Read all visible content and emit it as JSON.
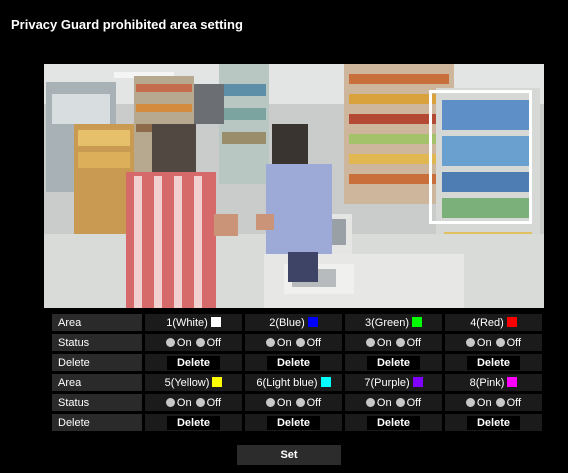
{
  "page": {
    "title": "Privacy Guard prohibited area setting"
  },
  "areas_row1": [
    {
      "label": "1(White)",
      "color": "#ffffff"
    },
    {
      "label": "2(Blue)",
      "color": "#0000ff"
    },
    {
      "label": "3(Green)",
      "color": "#00ff00"
    },
    {
      "label": "4(Red)",
      "color": "#ff0000"
    }
  ],
  "areas_row2": [
    {
      "label": "5(Yellow)",
      "color": "#ffff00"
    },
    {
      "label": "6(Light blue)",
      "color": "#00ffff"
    },
    {
      "label": "7(Purple)",
      "color": "#8000ff"
    },
    {
      "label": "8(Pink)",
      "color": "#ff00ff"
    }
  ],
  "labels": {
    "area": "Area",
    "status": "Status",
    "delete": "Delete",
    "on": "On",
    "off": "Off",
    "delete_button": "Delete",
    "set_button": "Set"
  }
}
